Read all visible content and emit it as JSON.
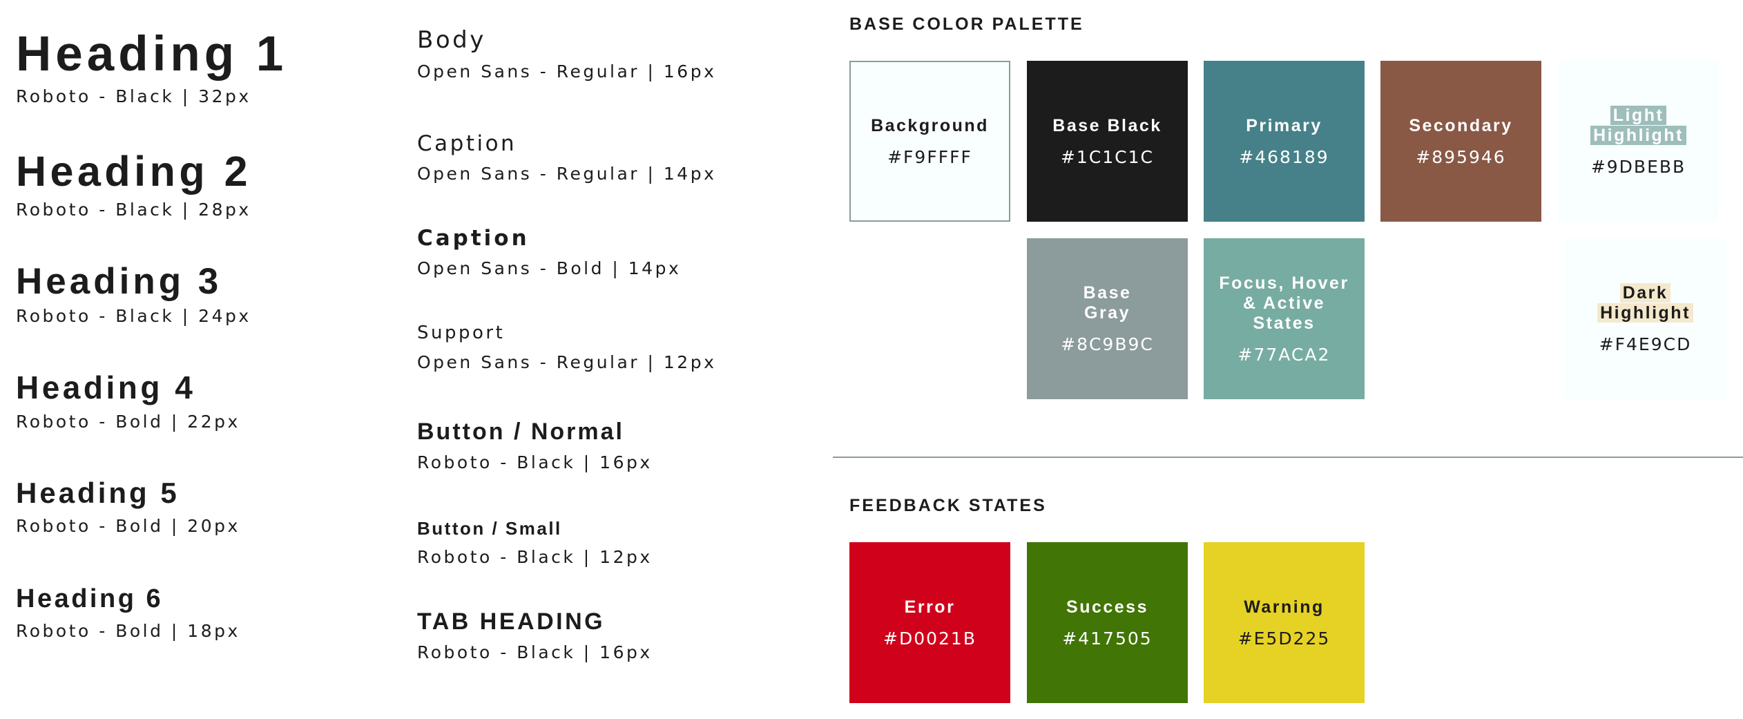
{
  "headings": [
    {
      "label": "Heading 1",
      "spec": "Roboto - Black | 32px"
    },
    {
      "label": "Heading 2",
      "spec": "Roboto - Black | 28px"
    },
    {
      "label": "Heading 3",
      "spec": "Roboto - Black | 24px"
    },
    {
      "label": "Heading 4",
      "spec": "Roboto - Bold | 22px"
    },
    {
      "label": "Heading 5",
      "spec": "Roboto - Bold | 20px"
    },
    {
      "label": "Heading 6",
      "spec": "Roboto - Bold | 18px"
    }
  ],
  "type_styles": [
    {
      "label": "Body",
      "spec": "Open Sans - Regular | 16px"
    },
    {
      "label": "Caption",
      "spec": "Open Sans - Regular | 14px"
    },
    {
      "label": "Caption",
      "spec": "Open Sans - Bold | 14px"
    },
    {
      "label": "Support",
      "spec": "Open Sans - Regular | 12px"
    },
    {
      "label": "Button / Normal",
      "spec": "Roboto - Black | 16px"
    },
    {
      "label": "Button / Small",
      "spec": "Roboto - Black | 12px"
    },
    {
      "label": "TAB HEADING",
      "spec": "Roboto - Black | 16px"
    }
  ],
  "palette": {
    "title": "BASE COLOR PALETTE",
    "swatches": [
      {
        "name": "Background",
        "hex": "#F9FFFF",
        "color": "#F9FFFF"
      },
      {
        "name": "Base Black",
        "hex": "#1C1C1C",
        "color": "#1C1C1C"
      },
      {
        "name": "Primary",
        "hex": "#468189",
        "color": "#468189"
      },
      {
        "name": "Secondary",
        "hex": "#895946",
        "color": "#895946"
      },
      {
        "name_line1": "Light",
        "name_line2": "Highlight",
        "hex": "#9DBEBB",
        "color": "#9DBEBB"
      },
      {
        "name_line1": "Base",
        "name_line2": "Gray",
        "hex": "#8C9B9C",
        "color": "#8C9B9C"
      },
      {
        "name_line1": "Focus, Hover",
        "name_line2": "& Active",
        "name_line3": "States",
        "hex": "#77ACA2",
        "color": "#77ACA2"
      },
      {
        "name_line1": "Dark",
        "name_line2": "Highlight",
        "hex": "#F4E9CD",
        "color": "#F4E9CD"
      }
    ]
  },
  "feedback": {
    "title": "FEEDBACK STATES",
    "swatches": [
      {
        "name": "Error",
        "hex": "#D0021B",
        "color": "#D0021B"
      },
      {
        "name": "Success",
        "hex": "#417505",
        "color": "#417505"
      },
      {
        "name": "Warning",
        "hex": "#E5D225",
        "color": "#E5D225"
      }
    ]
  }
}
